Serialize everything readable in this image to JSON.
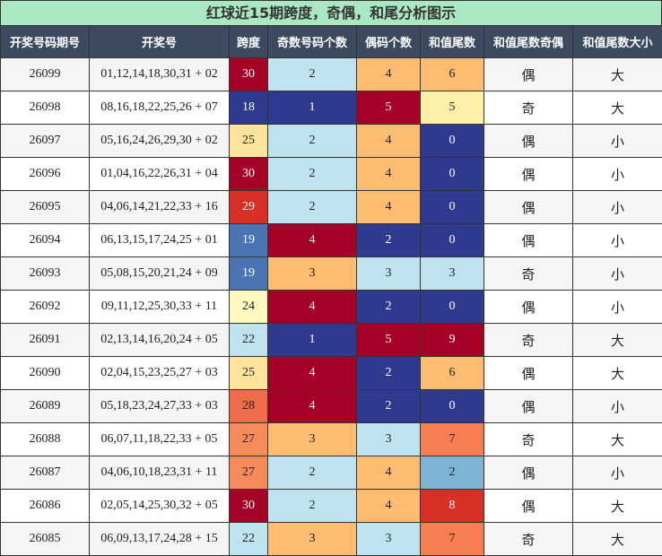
{
  "title": "红球近15期跨度，奇偶，和尾分析图示",
  "headers": [
    "开奖号码期号",
    "开奖号",
    "跨度",
    "奇数号码个数",
    "偶码个数",
    "和值尾数",
    "和值尾数奇偶",
    "和值尾数大小"
  ],
  "rows": [
    {
      "issue": "26099",
      "numbers": "01,12,14,18,30,31 + 02",
      "span": "30",
      "odd": "2",
      "even": "4",
      "tail": "6",
      "parity": "偶",
      "size": "大"
    },
    {
      "issue": "26098",
      "numbers": "08,16,18,22,25,26 + 07",
      "span": "18",
      "odd": "1",
      "even": "5",
      "tail": "5",
      "parity": "奇",
      "size": "大"
    },
    {
      "issue": "26097",
      "numbers": "05,16,24,26,29,30 + 02",
      "span": "25",
      "odd": "2",
      "even": "4",
      "tail": "0",
      "parity": "偶",
      "size": "小"
    },
    {
      "issue": "26096",
      "numbers": "01,04,16,22,26,31 + 04",
      "span": "30",
      "odd": "2",
      "even": "4",
      "tail": "0",
      "parity": "偶",
      "size": "小"
    },
    {
      "issue": "26095",
      "numbers": "04,06,14,21,22,33 + 16",
      "span": "29",
      "odd": "2",
      "even": "4",
      "tail": "0",
      "parity": "偶",
      "size": "小"
    },
    {
      "issue": "26094",
      "numbers": "06,13,15,17,24,25 + 01",
      "span": "19",
      "odd": "4",
      "even": "2",
      "tail": "0",
      "parity": "偶",
      "size": "小"
    },
    {
      "issue": "26093",
      "numbers": "05,08,15,20,21,24 + 09",
      "span": "19",
      "odd": "3",
      "even": "3",
      "tail": "3",
      "parity": "奇",
      "size": "小"
    },
    {
      "issue": "26092",
      "numbers": "09,11,12,25,30,33 + 11",
      "span": "24",
      "odd": "4",
      "even": "2",
      "tail": "0",
      "parity": "偶",
      "size": "小"
    },
    {
      "issue": "26091",
      "numbers": "02,13,14,16,20,24 + 05",
      "span": "22",
      "odd": "1",
      "even": "5",
      "tail": "9",
      "parity": "奇",
      "size": "大"
    },
    {
      "issue": "26090",
      "numbers": "02,04,15,23,25,27 + 03",
      "span": "25",
      "odd": "4",
      "even": "2",
      "tail": "6",
      "parity": "偶",
      "size": "大"
    },
    {
      "issue": "26089",
      "numbers": "05,18,23,24,27,33 + 03",
      "span": "28",
      "odd": "4",
      "even": "2",
      "tail": "0",
      "parity": "偶",
      "size": "小"
    },
    {
      "issue": "26088",
      "numbers": "06,07,11,18,22,33 + 05",
      "span": "27",
      "odd": "3",
      "even": "3",
      "tail": "7",
      "parity": "奇",
      "size": "大"
    },
    {
      "issue": "26087",
      "numbers": "04,06,10,18,23,31 + 11",
      "span": "27",
      "odd": "2",
      "even": "4",
      "tail": "2",
      "parity": "偶",
      "size": "小"
    },
    {
      "issue": "26086",
      "numbers": "02,05,14,25,30,32 + 05",
      "span": "30",
      "odd": "2",
      "even": "4",
      "tail": "8",
      "parity": "偶",
      "size": "大"
    },
    {
      "issue": "26085",
      "numbers": "06,09,13,17,24,28 + 15",
      "span": "22",
      "odd": "3",
      "even": "3",
      "tail": "7",
      "parity": "奇",
      "size": "大"
    }
  ],
  "colors": {
    "title_bg": "#a9e8c3",
    "header_bg": "#3b4a5e",
    "span": {
      "18": "#2f3a8f",
      "19": "#4a74b4",
      "22": "#bfe3ee",
      "24": "#fff8c0",
      "25": "#fee39a",
      "27": "#f68b5a",
      "28": "#ee6c4a",
      "29": "#d73027",
      "30": "#a50026"
    },
    "oddcount": {
      "1": "#2f3a8f",
      "2": "#bfe3ee",
      "3": "#fdbc72",
      "4": "#a50026"
    },
    "evencount": {
      "2": "#2f3a8f",
      "3": "#bfe3ee",
      "4": "#fdbc72",
      "5": "#a50026"
    },
    "tail": {
      "0": "#2f3a8f",
      "2": "#7fb3d6",
      "3": "#bfe3ee",
      "5": "#fff0a8",
      "6": "#fdbc72",
      "7": "#f67e50",
      "8": "#d73027",
      "9": "#a50026"
    },
    "dark_text_on": [
      "#2f3a8f",
      "#a50026",
      "#d73027",
      "#4a74b4"
    ]
  }
}
